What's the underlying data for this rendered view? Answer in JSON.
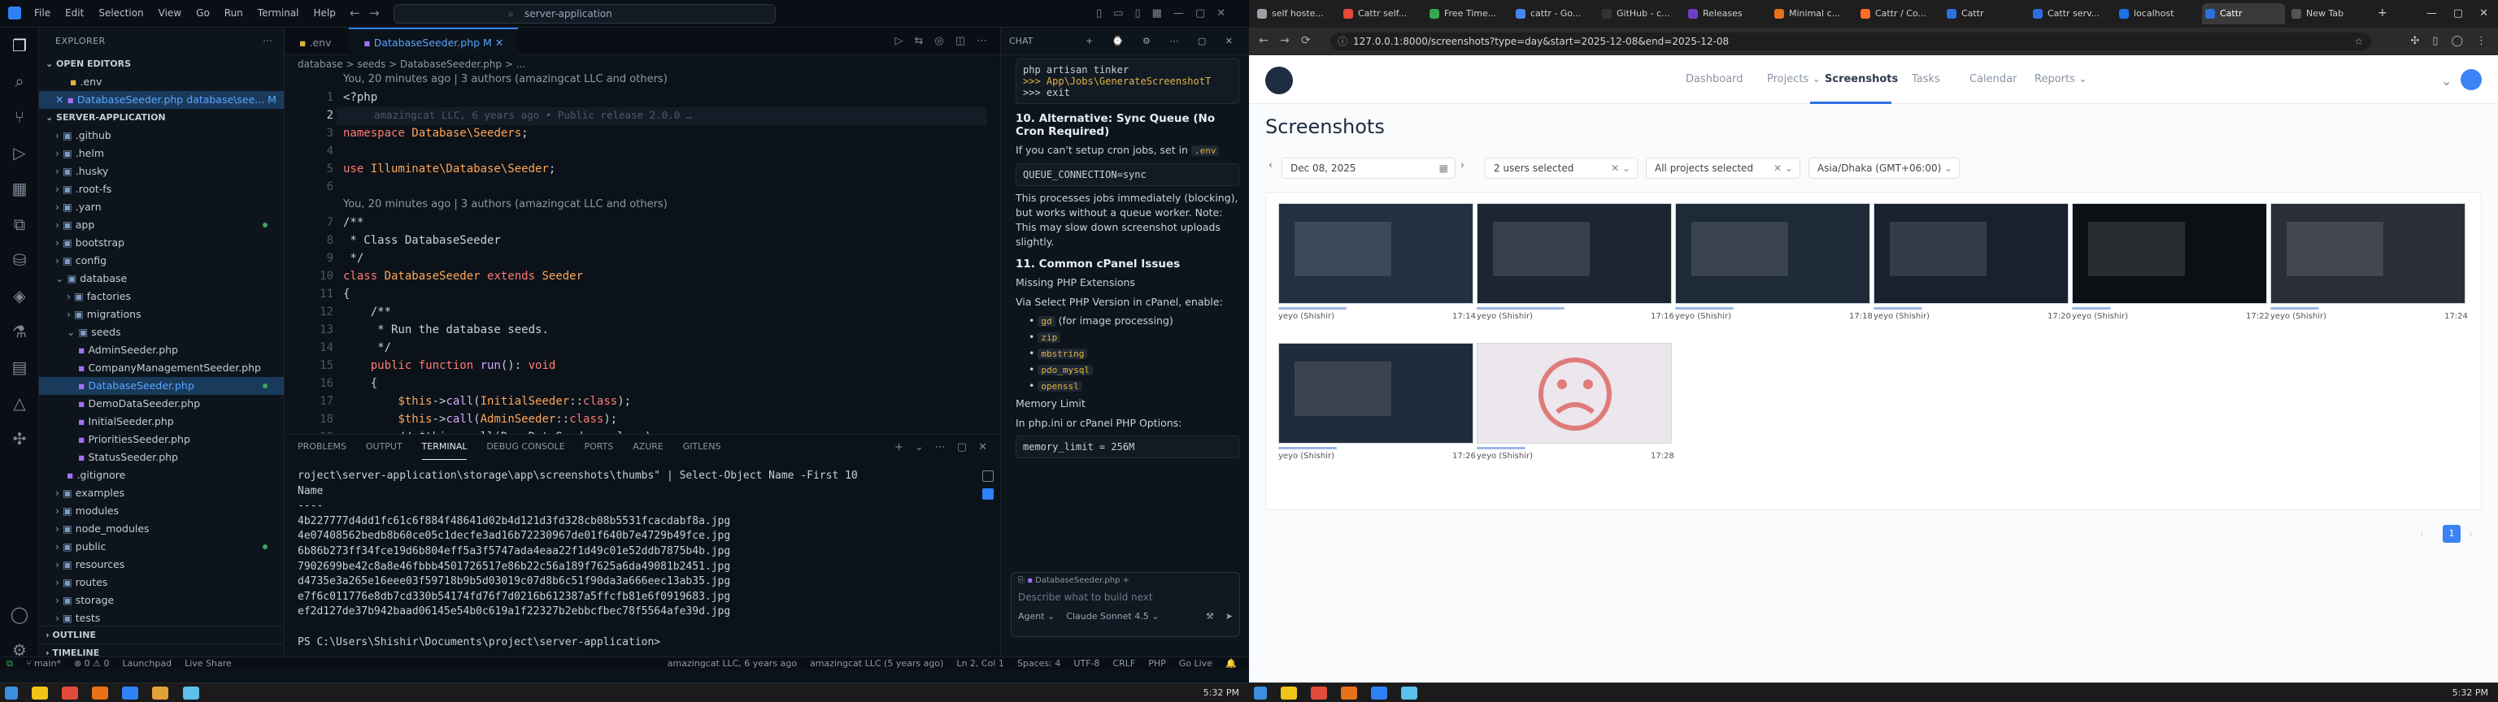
{
  "vscode": {
    "menu": [
      "File",
      "Edit",
      "Selection",
      "View",
      "Go",
      "Run",
      "Terminal",
      "Help"
    ],
    "command_center": "server-application",
    "explorer_title": "EXPLORER",
    "open_editors_title": "OPEN EDITORS",
    "open_editors": [
      ".env",
      "DatabaseSeeder.php  database\\see...  M"
    ],
    "project_title": "SERVER-APPLICATION",
    "tree": [
      ".github",
      ".helm",
      ".husky",
      ".root-fs",
      ".yarn",
      "app",
      "bootstrap",
      "config",
      "database",
      "factories",
      "migrations",
      "seeds",
      "AdminSeeder.php",
      "CompanyManagementSeeder.php",
      "DatabaseSeeder.php",
      "DemoDataSeeder.php",
      "InitialSeeder.php",
      "PrioritiesSeeder.php",
      "StatusSeeder.php",
      ".gitignore",
      "examples",
      "modules",
      "node_modules",
      "public",
      "resources",
      "routes",
      "storage",
      "tests"
    ],
    "outline_label": "OUTLINE",
    "timeline_label": "TIMELINE",
    "tabs": [
      ".env",
      "DatabaseSeeder.php  M"
    ],
    "breadcrumb": "database  >  seeds  >  DatabaseSeeder.php  >  ...",
    "blame_1": "You, 20 minutes ago | 3 authors (amazingcat LLC and others)",
    "blame_2": "You, 20 minutes ago | 3 authors (amazingcat LLC and others)",
    "code": {
      "l1": "<?php",
      "l2_hint": "amazingcat LLC, 6 years ago • Public release 2.0.0 …",
      "l3": "namespace Database\\Seeders;",
      "l5": "use Illuminate\\Database\\Seeder;",
      "l7": "/**",
      "l8": " * Class DatabaseSeeder",
      "l9": " */",
      "l10": "class DatabaseSeeder extends Seeder",
      "l11": "{",
      "l12": "    /**",
      "l13": "     * Run the database seeds.",
      "l14": "     */",
      "l15": "    public function run(): void",
      "l16": "    {",
      "l17": "        $this->call(InitialSeeder::class);",
      "l18": "        $this->call(AdminSeeder::class);",
      "l19": "        // $this->call(DemoDataSeeder::class);"
    },
    "panel_tabs": [
      "PROBLEMS",
      "OUTPUT",
      "TERMINAL",
      "DEBUG CONSOLE",
      "PORTS",
      "AZURE",
      "GITLENS"
    ],
    "terminal_lines": [
      "roject\\server-application\\storage\\app\\screenshots\\thumbs\" | Select-Object Name -First 10",
      "Name",
      "----",
      "4b227777d4dd1fc61c6f884f48641d02b4d121d3fd328cb08b5531fcacdabf8a.jpg",
      "4e07408562bedb8b60ce05c1decfe3ad16b72230967de01f640b7e4729b49fce.jpg",
      "6b86b273ff34fce19d6b804eff5a3f5747ada4eaa22f1d49c01e52ddb7875b4b.jpg",
      "7902699be42c8a8e46fbbb4501726517e86b22c56a189f7625a6da49081b2451.jpg",
      "d4735e3a265e16eee03f59718b9b5d03019c07d8b6c51f90da3a666eec13ab35.jpg",
      "e7f6c011776e8db7cd330b54174fd76f7d0216b612387a5ffcfb81e6f0919683.jpg",
      "ef2d127de37b942baad06145e54b0c619a1f22327b2ebbcfbec78f5564afe39d.jpg",
      "",
      "PS C:\\Users\\Shishir\\Documents\\project\\server-application>"
    ],
    "chat": {
      "header": "CHAT",
      "code_top": [
        "php artisan tinker",
        ">>> App\\Jobs\\GenerateScreenshotT",
        ">>> exit"
      ],
      "h10": "10. Alternative: Sync Queue (No Cron Required)",
      "p10": "If you can't setup cron jobs, set in",
      "env_name": ".env",
      "code_queue": "QUEUE_CONNECTION=sync",
      "p_sync": "This processes jobs immediately (blocking), but works without a queue worker. Note: This may slow down screenshot uploads slightly.",
      "h11": "11. Common cPanel Issues",
      "missing_ext": "Missing PHP Extensions",
      "via": "Via Select PHP Version in cPanel, enable:",
      "exts": [
        "gd",
        "zip",
        "mbstring",
        "pdo_mysql",
        "openssl"
      ],
      "gd_note": "(for image processing)",
      "mem_title": "Memory Limit",
      "mem_text": "In php.ini or cPanel PHP Options:",
      "code_mem": "memory_limit = 256M",
      "attach": "DatabaseSeeder.php",
      "input_placeholder": "Describe what to build next",
      "mode": "Agent",
      "model": "Claude Sonnet 4.5"
    },
    "status": {
      "branch": "main*",
      "errors": "0",
      "warnings": "0",
      "launchpad": "Launchpad",
      "liveshare": "Live Share",
      "blame": "amazingcat LLC, 6 years ago",
      "blame2": "amazingcat LLC (5 years ago)",
      "pos": "Ln 2, Col 1",
      "spaces": "Spaces: 4",
      "enc": "UTF-8",
      "eol": "CRLF",
      "lang": "PHP",
      "golive": "Go Live"
    }
  },
  "taskbar_left": {
    "time": "5:32 PM"
  },
  "browser": {
    "tabs": [
      "self hoste...",
      "Cattr self...",
      "Free Time...",
      "cattr - Go...",
      "GitHub - c...",
      "Releases",
      "Minimal c...",
      "Cattr / Co...",
      "Cattr",
      "Cattr serv...",
      "localhost",
      "Cattr",
      "New Tab"
    ],
    "url": "127.0.0.1:8000/screenshots?type=day&start=2025-12-08&end=2025-12-08",
    "nav": [
      "Dashboard",
      "Projects",
      "Screenshots",
      "Tasks",
      "Calendar",
      "Reports"
    ],
    "page_title": "Screenshots",
    "date": "Dec 08, 2025",
    "users_filter": "2 users selected",
    "projects_filter": "All projects selected",
    "timezone": "Asia/Dhaka (GMT+06:00)",
    "screens": [
      {
        "user": "yeyo (Shishir)",
        "time": "17:14",
        "progress": 0.35
      },
      {
        "user": "yeyo (Shishir)",
        "time": "17:16",
        "progress": 0.45
      },
      {
        "user": "yeyo (Shishir)",
        "time": "17:18",
        "progress": 0.3
      },
      {
        "user": "yeyo (Shishir)",
        "time": "17:20",
        "progress": 0.25
      },
      {
        "user": "yeyo (Shishir)",
        "time": "17:22",
        "progress": 0.2
      },
      {
        "user": "yeyo (Shishir)",
        "time": "17:24",
        "progress": 0.25
      },
      {
        "user": "yeyo (Shishir)",
        "time": "17:26",
        "progress": 0.3
      },
      {
        "user": "yeyo (Shishir)",
        "time": "17:28",
        "progress": 0.25
      }
    ],
    "page_number": "1",
    "time": "5:32 PM"
  }
}
